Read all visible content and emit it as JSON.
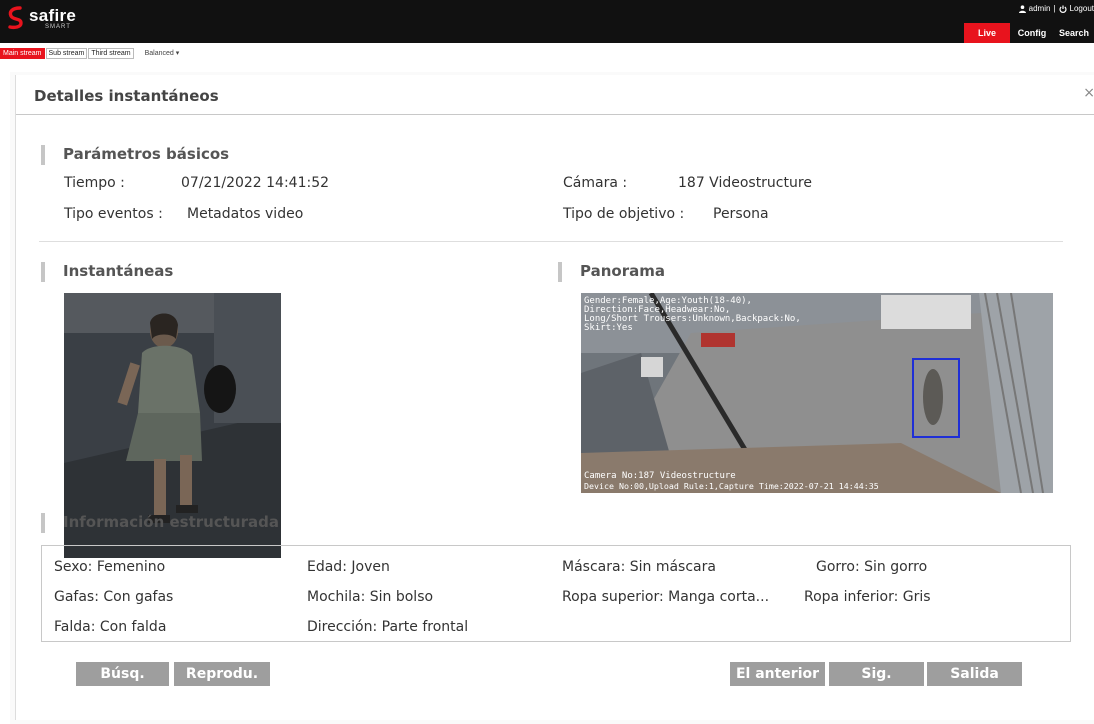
{
  "app": {
    "logo_text": "safire",
    "logo_sub": "SMART"
  },
  "topbar": {
    "user": "admin",
    "separator": "|",
    "logout": "Logout",
    "tabs": [
      {
        "label": "Live",
        "active": true
      },
      {
        "label": "Config",
        "active": false
      },
      {
        "label": "Search",
        "active": false
      }
    ]
  },
  "streambar": {
    "streams": [
      {
        "label": "Main stream",
        "active": true
      },
      {
        "label": "Sub stream",
        "active": false
      },
      {
        "label": "Third stream",
        "active": false
      }
    ],
    "quality": "Balanced",
    "quality_caret": "▾"
  },
  "panel": {
    "title": "Detalles instantáneos",
    "close": "×"
  },
  "basic": {
    "title": "Parámetros básicos",
    "tiempo_label": "Tiempo :",
    "tiempo_value": "07/21/2022 14:41:52",
    "camara_label": "Cámara :",
    "camara_value": "187 Videostructure",
    "tipo_eventos_label": "Tipo eventos :",
    "tipo_eventos_value": "Metadatos video",
    "tipo_objetivo_label": "Tipo de objetivo :",
    "tipo_objetivo_value": "Persona"
  },
  "snapshots": {
    "title": "Instantáneas"
  },
  "panorama": {
    "title": "Panorama",
    "overlay_lines": [
      "Gender:Female,Age:Youth(18-40),",
      "Direction:Face,Headwear:No,",
      "Long/Short Trousers:Unknown,Backpack:No,",
      "Skirt:Yes"
    ],
    "overlay_bottom_1": "Camera No:187 Videostructure",
    "overlay_bottom_2": "Device No:00,Upload Rule:1,Capture Time:2022-07-21 14:44:35"
  },
  "structured": {
    "title": "Información estructurada",
    "items": [
      {
        "label": "Sexo:",
        "value": "Femenino"
      },
      {
        "label": "Edad:",
        "value": "Joven"
      },
      {
        "label": "Máscara:",
        "value": "Sin máscara"
      },
      {
        "label": "Gorro:",
        "value": "Sin gorro"
      },
      {
        "label": "Gafas:",
        "value": "Con gafas"
      },
      {
        "label": "Mochila:",
        "value": "Sin bolso"
      },
      {
        "label": "Ropa superior:",
        "value": "Manga corta..."
      },
      {
        "label": "Ropa inferior:",
        "value": "Gris"
      },
      {
        "label": "Falda:",
        "value": "Con falda"
      },
      {
        "label": "Dirección:",
        "value": "Parte frontal"
      }
    ]
  },
  "buttons": {
    "search": "Búsq.",
    "play": "Reprodu.",
    "previous": "El anterior",
    "next": "Sig.",
    "exit": "Salida"
  },
  "colors": {
    "accent": "#e8131d",
    "button": "#9e9e9e",
    "topbar": "#111111"
  }
}
